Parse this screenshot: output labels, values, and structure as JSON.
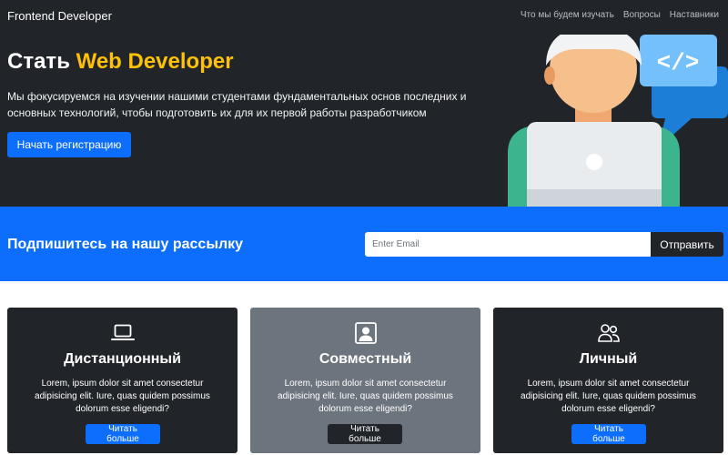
{
  "nav": {
    "brand": "Frontend Developer",
    "links": [
      "Что мы будем изучать",
      "Вопросы",
      "Наставники"
    ]
  },
  "hero": {
    "title_prefix": "Стать ",
    "title_accent": "Web Developer",
    "description": "Мы фокусируемся на изучении нашими студентами фундаментальных основ последних и основных технологий, чтобы подготовить их для их первой работы разработчиком",
    "cta_label": "Начать регистрацию",
    "code_symbol": "</>"
  },
  "newsletter": {
    "title": "Подпишитесь на нашу рассылку",
    "email_placeholder": "Enter Email",
    "submit_label": "Отправить"
  },
  "cards": [
    {
      "icon": "laptop-icon",
      "title": "Дистанционный",
      "text": "Lorem, ipsum dolor sit amet consectetur adipisicing elit. Iure, quas quidem possimus dolorum esse eligendi?",
      "button": "Читать больше"
    },
    {
      "icon": "person-square-icon",
      "title": "Совместный",
      "text": "Lorem, ipsum dolor sit amet consectetur adipisicing elit. Iure, quas quidem possimus dolorum esse eligendi?",
      "button": "Читать больше"
    },
    {
      "icon": "people-icon",
      "title": "Личный",
      "text": "Lorem, ipsum dolor sit amet consectetur adipisicing elit. Iure, quas quidem possimus dolorum esse eligendi?",
      "button": "Читать больше"
    }
  ],
  "colors": {
    "dark": "#212529",
    "primary": "#0d6efd",
    "warning": "#ffc107",
    "secondary": "#6c757d"
  }
}
